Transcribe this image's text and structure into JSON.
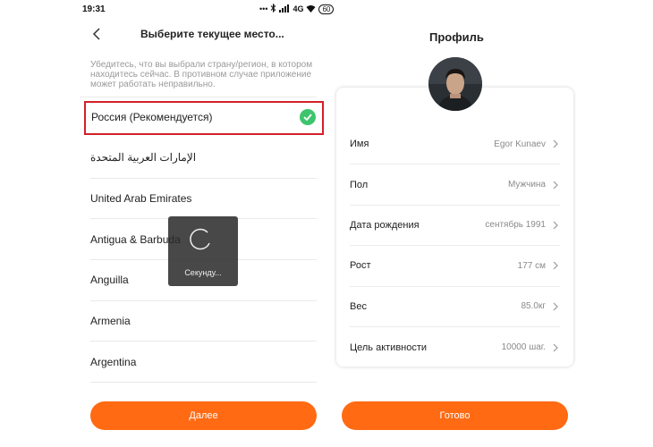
{
  "status_bar": {
    "time": "19:31",
    "icons_text": "•••",
    "network": "4G",
    "battery": "60"
  },
  "left_screen": {
    "title": "Выберите текущее место...",
    "notice": "Убедитесь, что вы выбрали страну/регион, в котором находитесь сейчас. В противном случае приложение может работать неправильно.",
    "recommended": "Россия (Рекомендуется)",
    "countries": [
      "الإمارات العربية المتحدة",
      "United Arab Emirates",
      "Antigua & Barbuda",
      "Anguilla",
      "Armenia",
      "Argentina"
    ],
    "loading_text": "Секунду...",
    "next_button": "Далее"
  },
  "right_screen": {
    "title": "Профиль",
    "rows": [
      {
        "label": "Имя",
        "value": "Egor Kunaev"
      },
      {
        "label": "Пол",
        "value": "Мужчина"
      },
      {
        "label": "Дата рождения",
        "value": "сентябрь 1991"
      },
      {
        "label": "Рост",
        "value": "177 см"
      },
      {
        "label": "Вес",
        "value": "85.0кг"
      },
      {
        "label": "Цель активности",
        "value": "10000 шаг."
      }
    ],
    "done_button": "Готово"
  },
  "colors": {
    "accent": "#ff6a13",
    "highlight": "#d2202a",
    "check": "#3ec46d"
  }
}
